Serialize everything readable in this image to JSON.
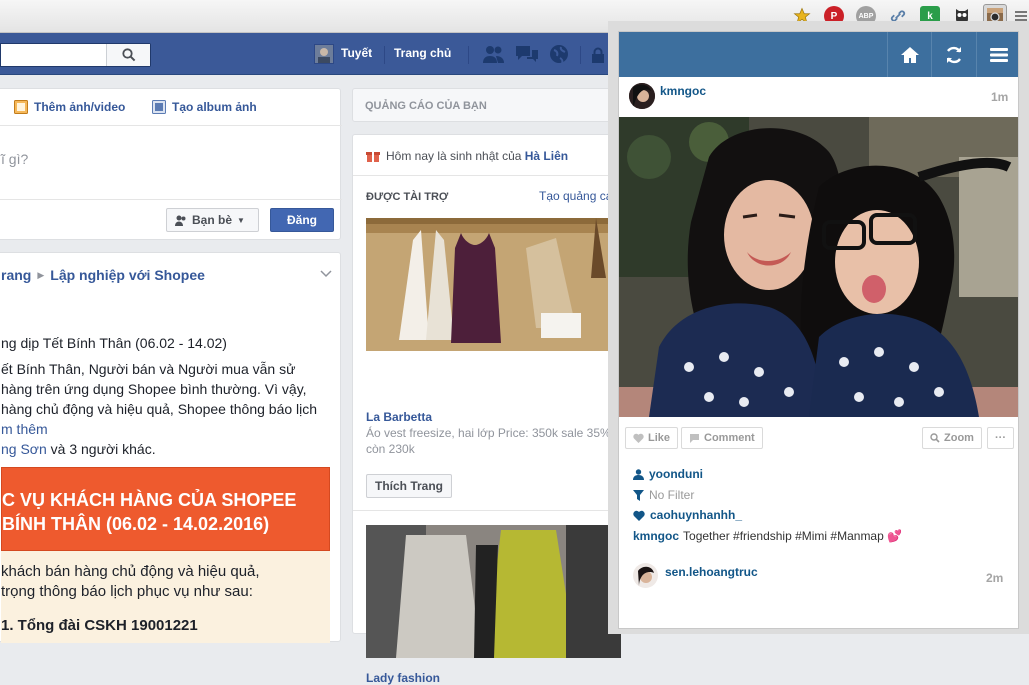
{
  "browser": {
    "extensions": [
      {
        "icon": "star-icon",
        "color": "#e8b41c"
      },
      {
        "icon": "pinterest-icon",
        "color": "#cb2027"
      },
      {
        "icon": "adblock-icon",
        "color": "#9a9a9a",
        "label": "ABP"
      },
      {
        "icon": "link-icon",
        "color": "#5a7fa8",
        "badge": "0"
      },
      {
        "icon": "k-extension-icon",
        "color": "#2a9d4a",
        "label": "k"
      },
      {
        "icon": "owl-icon",
        "color": "#333333"
      },
      {
        "icon": "instagram-icon",
        "color": "#8a6a4a"
      },
      {
        "icon": "chrome-menu-icon",
        "color": "#777777"
      }
    ]
  },
  "facebook": {
    "header": {
      "search_icon": "search-icon",
      "profile_name": "Tuyết",
      "home_label": "Trang chủ"
    },
    "composer": {
      "add_photo_label": "Thêm ảnh/video",
      "create_album_label": "Tạo album ảnh",
      "prompt": "ĩ gì?",
      "audience_label": "Bạn bè",
      "post_label": "Đăng"
    },
    "post": {
      "breadcrumb_left": "rang",
      "breadcrumb_right": "Lập nghiệp với Shopee",
      "lines": [
        "ng dịp Tết Bính Thân (06.02 - 14.02)",
        "ết Bính Thân, Người bán và Người mua vẫn sử",
        " hàng trên ứng dụng Shopee bình thường. Vì vậy,",
        "hàng chủ động và hiệu quả, Shopee thông báo lịch"
      ],
      "see_more": "m thêm",
      "likes_name": "ng Sơn",
      "likes_rest": " và 3 người khác.",
      "banner_line1": "C VỤ KHÁCH HÀNG CỦA SHOPEE",
      "banner_line2": "BÍNH THÂN (06.02 - 14.02.2016)",
      "body_line1": " khách bán hàng chủ động và hiệu quả,",
      "body_line2": " trọng thông báo lịch phục vụ như sau:",
      "body_line3": "1. Tổng đài CSKH 19001221"
    },
    "sidebar": {
      "your_ads_title": "QUẢNG CÁO CỦA BẠN",
      "birthday_prefix": "Hôm nay là sinh nhật của ",
      "birthday_name": "Hà Liên",
      "sponsored_title": "ĐƯỢC TÀI TRỢ",
      "create_ad_label": "Tạo quảng cáo",
      "ad1_title": "La Barbetta",
      "ad1_desc_line1": "Áo vest freesize, hai lớp Price: 350k sale 35%",
      "ad1_desc_line2": "còn 230k",
      "like_page_label": "Thích Trang",
      "ad2_title": "Lady fashion"
    }
  },
  "instagram_popup": {
    "header_icons": [
      "home-icon",
      "refresh-icon",
      "menu-icon"
    ],
    "post": {
      "username": "kmngoc",
      "time": "1m",
      "actions": {
        "like_label": "Like",
        "comment_label": "Comment",
        "zoom_label": "Zoom",
        "more_label": "···"
      },
      "tagged_user": "yoonduni",
      "filter_label": "No Filter",
      "liked_by": "caohuynhanhh_",
      "caption_user": "kmngoc",
      "caption_text": "Together #friendship #Mimi #Manmap 💕"
    },
    "next_post": {
      "username": "sen.lehoangtruc",
      "time": "2m"
    },
    "colors": {
      "header": "#3d6f9e",
      "link": "#125688"
    }
  }
}
